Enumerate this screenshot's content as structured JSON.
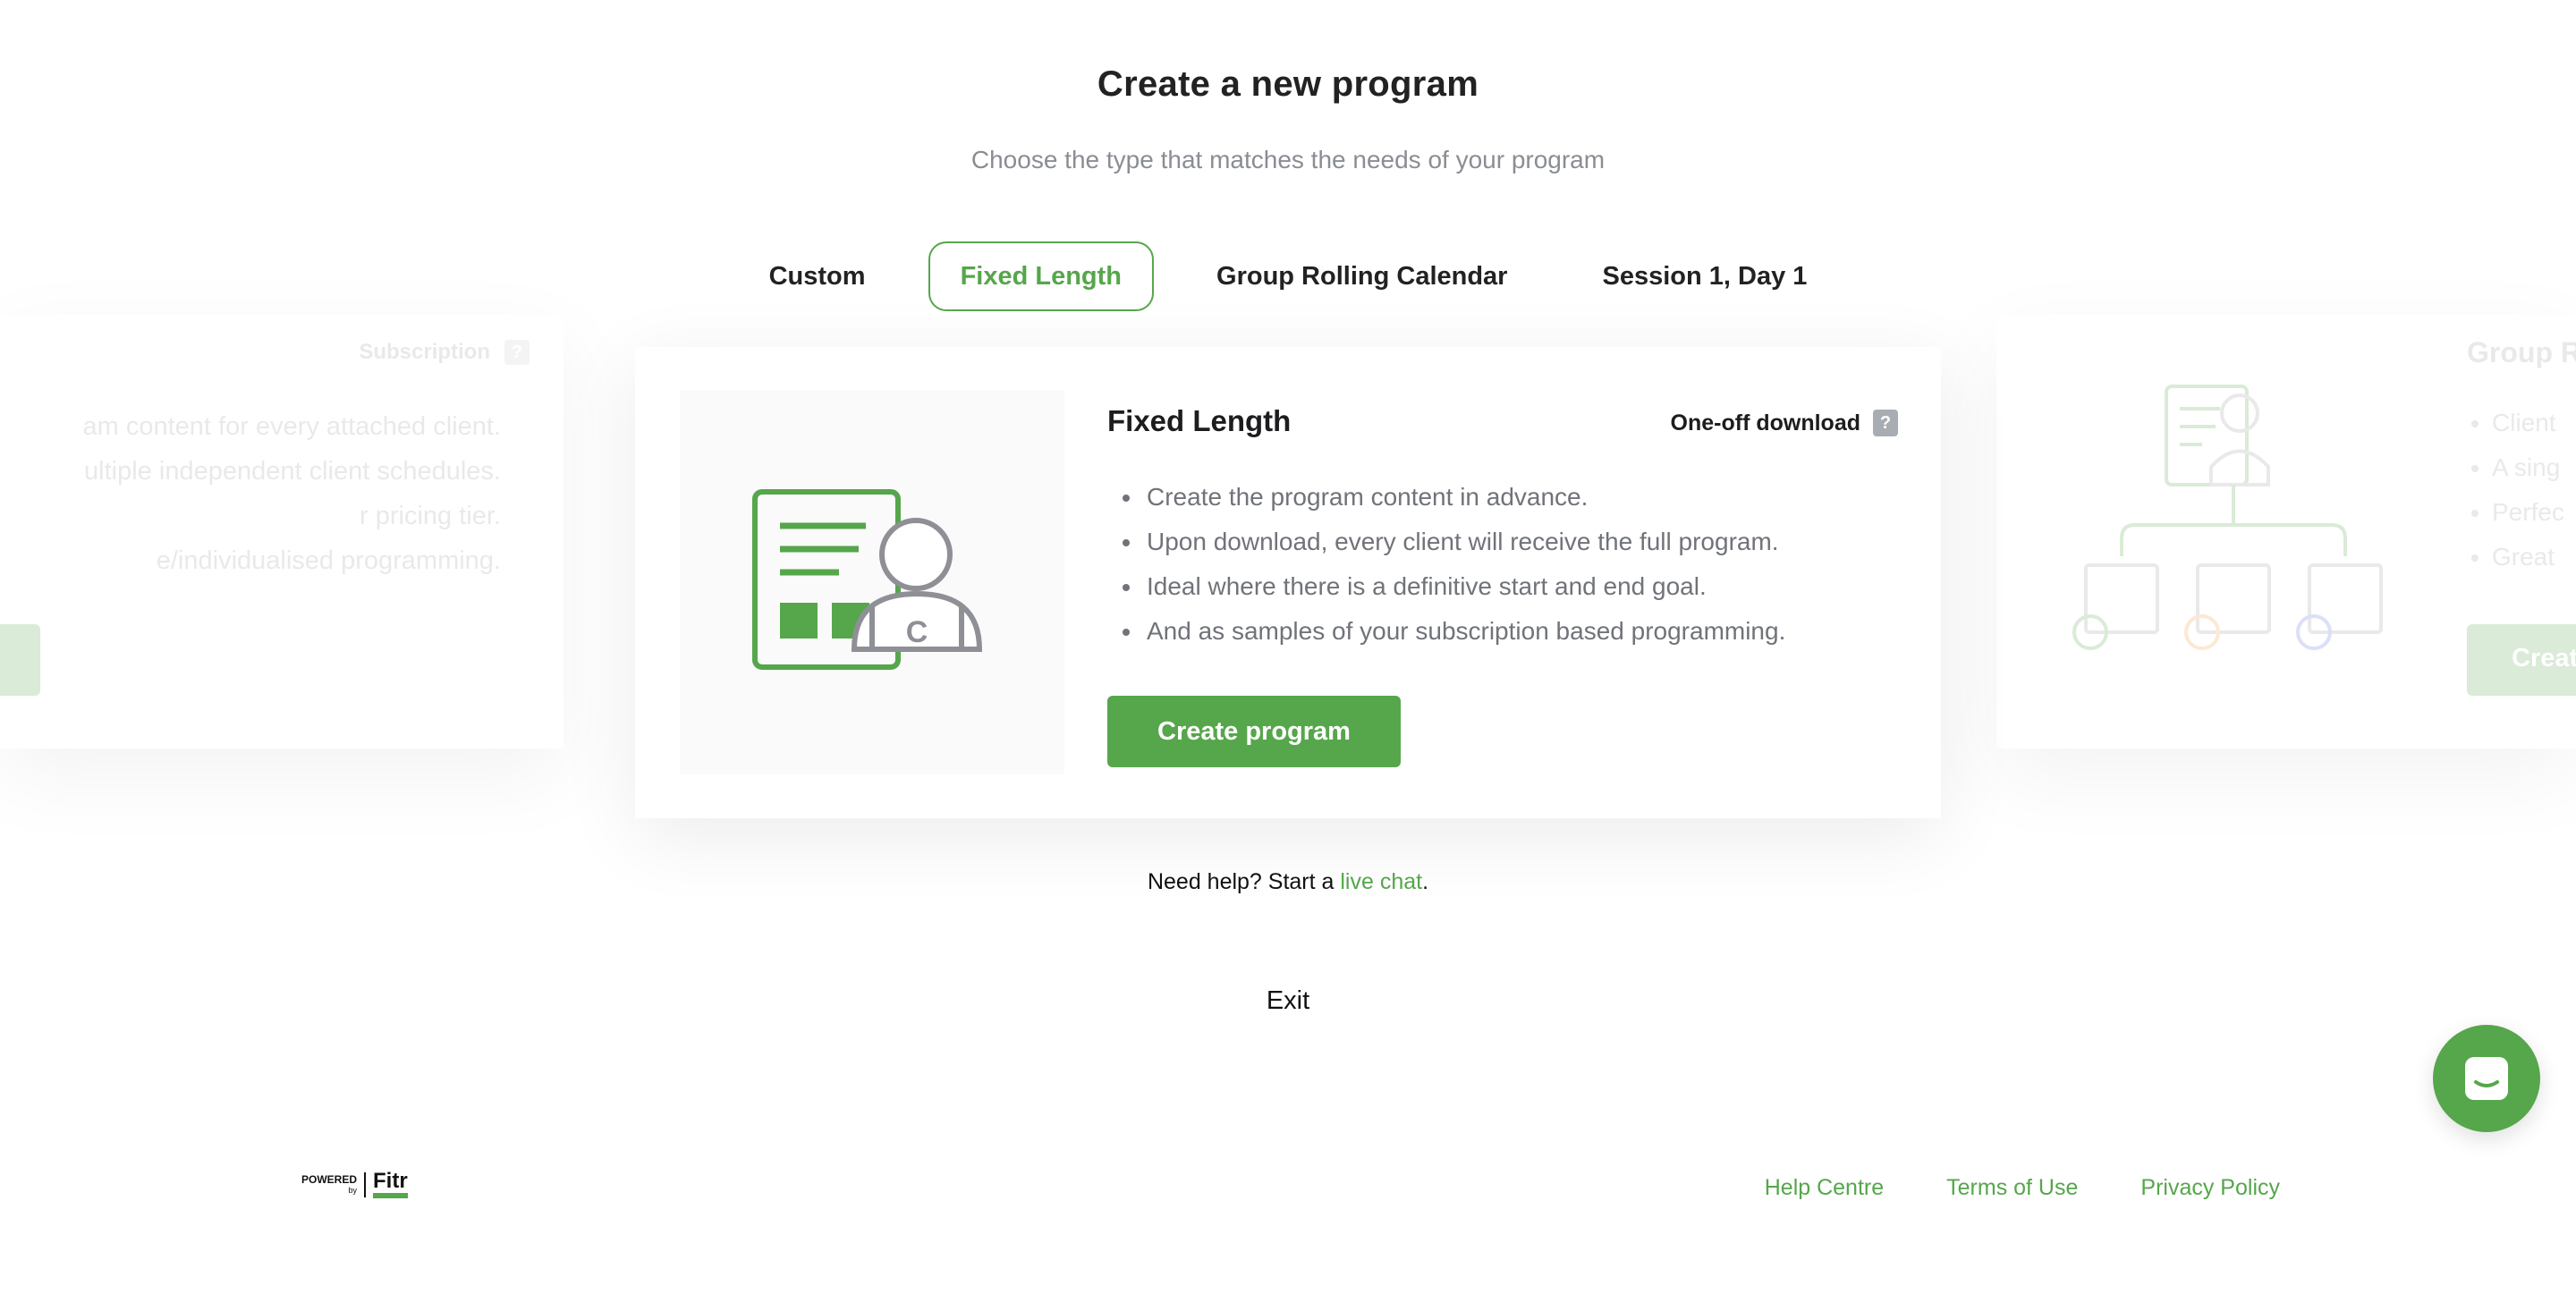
{
  "header": {
    "title": "Create a new program",
    "subtitle": "Choose the type that matches the needs of your program"
  },
  "tabs": [
    {
      "label": "Custom",
      "active": false
    },
    {
      "label": "Fixed Length",
      "active": true
    },
    {
      "label": "Group Rolling Calendar",
      "active": false
    },
    {
      "label": "Session 1, Day 1",
      "active": false
    }
  ],
  "ghost_left": {
    "badge": "Subscription",
    "badge_icon": "question-icon",
    "lines": [
      "am content for every attached client.",
      "ultiple independent client schedules.",
      "r pricing tier.",
      "e/individualised programming."
    ]
  },
  "ghost_right": {
    "title": "Group R",
    "items": [
      "Client",
      "A sing",
      "Perfec",
      "Great"
    ],
    "button_label": "Creat"
  },
  "card": {
    "title": "Fixed Length",
    "badge": "One-off download",
    "badge_icon": "question-icon",
    "illustration": "program-document-user-icon",
    "bullets": [
      "Create the program content in advance.",
      "Upon download, every client will receive the full program.",
      "Ideal where there is a definitive start and end goal.",
      "And as samples of your subscription based programming."
    ],
    "button_label": "Create program"
  },
  "help": {
    "prefix": "Need help? Start a ",
    "link": "live chat",
    "suffix": "."
  },
  "exit_label": "Exit",
  "chat_icon": "chat-bubble-icon",
  "footer": {
    "powered": "POWERED",
    "by": "by",
    "brand": "Fitr",
    "links": [
      "Help Centre",
      "Terms of Use",
      "Privacy Policy"
    ]
  },
  "colors": {
    "accent": "#56a64b",
    "muted_text": "#707379",
    "icon_grey": "#a8acb3"
  }
}
